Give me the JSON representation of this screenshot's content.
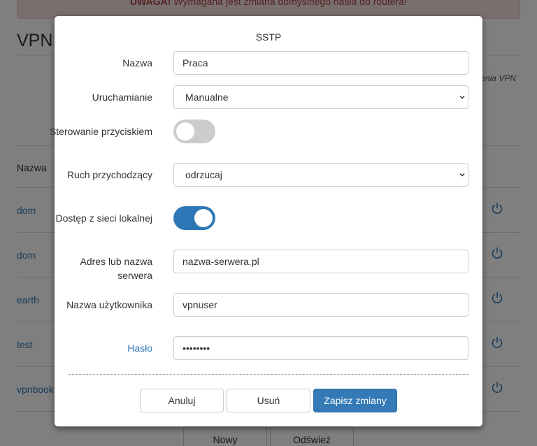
{
  "alert": {
    "strong": "UWAGA!",
    "text": " Wymagana jest zmiana domyślnego hasła do routera!"
  },
  "page": {
    "title": "VPN",
    "side_note": "enia VPN"
  },
  "table": {
    "header": "Nazwa",
    "rows": [
      {
        "name": "dom"
      },
      {
        "name": "dom"
      },
      {
        "name": "earth"
      },
      {
        "name": "test"
      },
      {
        "name": "vpnbook"
      }
    ]
  },
  "bg_buttons": {
    "new": "Nowy",
    "refresh": "Odśwież"
  },
  "modal": {
    "title": "SSTP",
    "fields": {
      "name": {
        "label": "Nazwa",
        "value": "Praca"
      },
      "startup": {
        "label": "Uruchamianie",
        "value": "Manualne"
      },
      "button_control": {
        "label": "Sterowanie przyciskiem",
        "state": "off"
      },
      "incoming": {
        "label": "Ruch przychodzący",
        "value": "odrzucaj"
      },
      "lan_access": {
        "label": "Dostęp z sieci lokalnej",
        "state": "on"
      },
      "server": {
        "label": "Adres lub nazwa serwera",
        "value": "nazwa-serwera.pl"
      },
      "username": {
        "label": "Nazwa użytkownika",
        "value": "vpnuser"
      },
      "password": {
        "label": "Hasło",
        "value": "••••••••"
      }
    },
    "buttons": {
      "cancel": "Anuluj",
      "delete": "Usuń",
      "save": "Zapisz zmiany"
    }
  },
  "colors": {
    "primary": "#337ab7",
    "toggle_on": "#2e77b7",
    "toggle_off": "#cccccc",
    "alert_bg": "#f2dede"
  }
}
